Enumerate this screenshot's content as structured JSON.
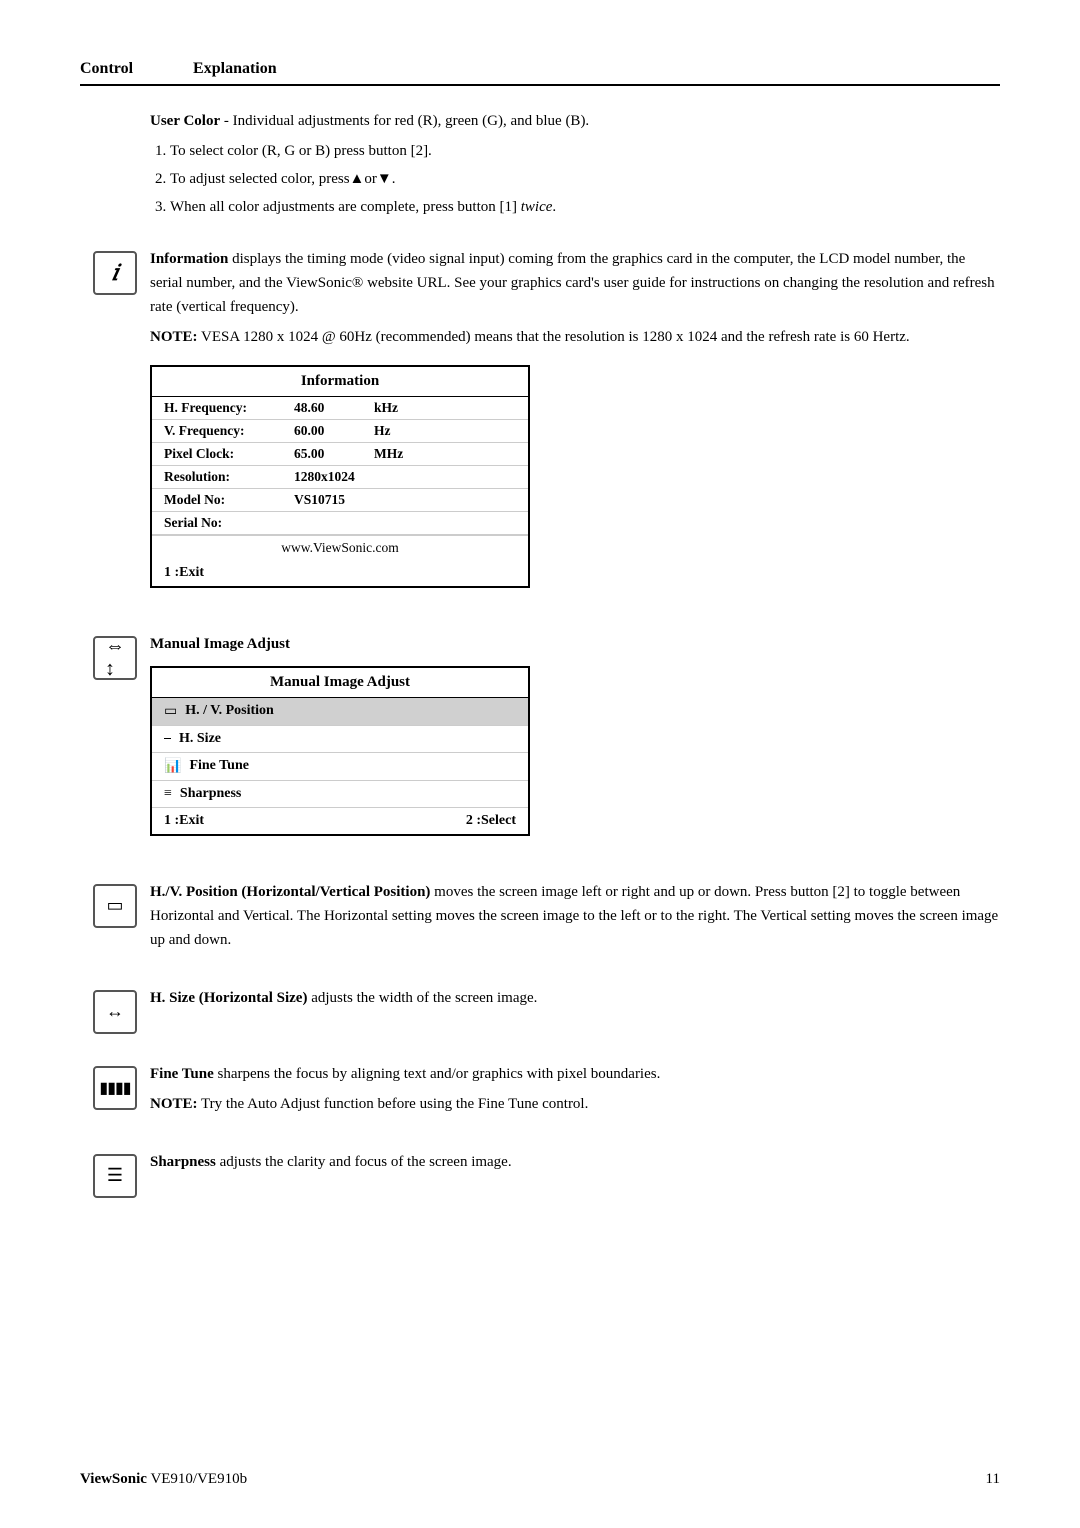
{
  "header": {
    "control_label": "Control",
    "explanation_label": "Explanation"
  },
  "user_color": {
    "title": "User Color",
    "intro": " - Individual adjustments for red (R), green (G),  and blue (B).",
    "steps": [
      "To select color (R, G or B) press button [2].",
      "To adjust selected color, press▲or▼.",
      "When all color adjustments are complete, press button [1] twice."
    ],
    "step3_italic": "twice"
  },
  "information_section": {
    "icon_label": "i",
    "intro_bold": "Information",
    "intro_text": " displays the timing mode (video signal input) coming from the graphics card in the computer, the LCD model number, the serial number, and the ViewSonic® website URL. See your graphics card's user guide for instructions on changing the resolution and refresh rate (vertical frequency).",
    "note_bold": "NOTE:",
    "note_text": " VESA 1280 x 1024 @ 60Hz (recommended) means that the resolution is 1280 x 1024 and the refresh rate is 60 Hertz.",
    "table": {
      "title": "Information",
      "rows": [
        {
          "label": "H. Frequency:",
          "value": "48.60",
          "unit": "kHz"
        },
        {
          "label": "V. Frequency:",
          "value": "60.00",
          "unit": "Hz"
        },
        {
          "label": "Pixel Clock:",
          "value": "65.00",
          "unit": "MHz"
        },
        {
          "label": "Resolution:",
          "value": "1280x1024",
          "unit": ""
        },
        {
          "label": "Model No:",
          "value": "VS10715",
          "unit": ""
        },
        {
          "label": "Serial No:",
          "value": "",
          "unit": ""
        }
      ],
      "website": "www.ViewSonic.com",
      "exit": "1 :Exit"
    }
  },
  "manual_image_adjust_section": {
    "heading": "Manual Image Adjust",
    "table": {
      "title": "Manual Image Adjust",
      "rows": [
        {
          "icon": "⊟",
          "label": "H. / V. Position",
          "highlighted": true
        },
        {
          "icon": "⊟",
          "label": "H. Size",
          "highlighted": false
        },
        {
          "icon": "𝌆",
          "label": "Fine Tune",
          "highlighted": false
        },
        {
          "icon": "≡",
          "label": "Sharpness",
          "highlighted": false
        }
      ],
      "exit": "1 :Exit",
      "select": "2 :Select"
    }
  },
  "hv_position_section": {
    "intro_bold": "H./V. Position (Horizontal/Vertical Position)",
    "intro_text": " moves the screen image left or right and up or down. Press button [2] to toggle between Horizontal and Vertical. The Horizontal setting moves the screen image to the left or to the right. The Vertical setting moves the screen image up and down."
  },
  "hsize_section": {
    "intro_bold": "H. Size (Horizontal Size)",
    "intro_text": " adjusts the width of the screen image."
  },
  "finetune_section": {
    "intro_bold": "Fine Tune",
    "intro_text": " sharpens the focus by aligning text and/or graphics with pixel boundaries.",
    "note_bold": "NOTE:",
    "note_text": " Try the Auto Adjust function before using the Fine Tune control."
  },
  "sharpness_section": {
    "intro_bold": "Sharpness",
    "intro_text": " adjusts the clarity and focus of the screen image."
  },
  "footer": {
    "brand": "ViewSonic",
    "model": "VE910/VE910b",
    "page": "11"
  }
}
